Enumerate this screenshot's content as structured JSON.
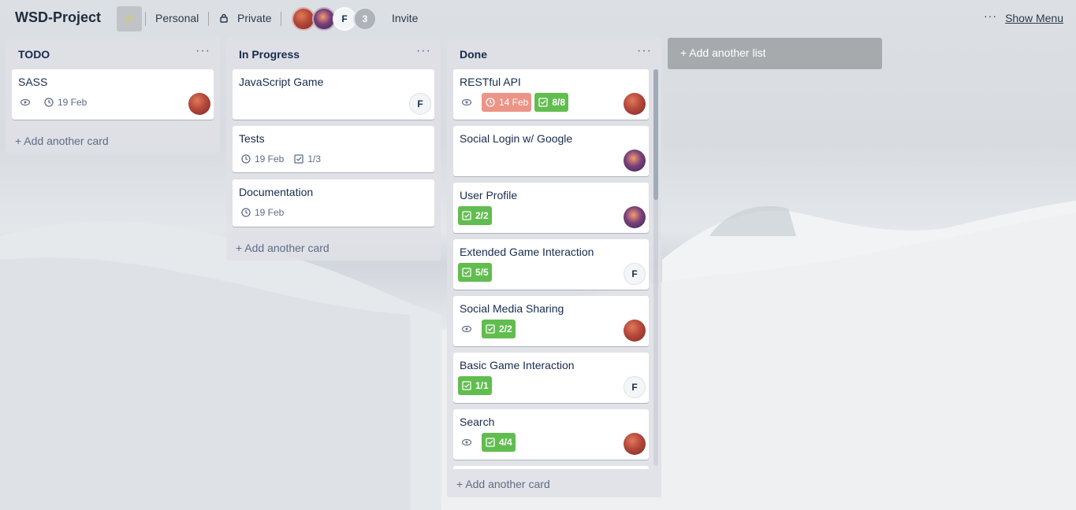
{
  "board": {
    "title": "WSD-Project",
    "team": "Personal",
    "visibility": "Private",
    "member_initial": "F",
    "member_extra_count": "3",
    "invite_label": "Invite",
    "show_menu_label": "Show Menu"
  },
  "lists": [
    {
      "title": "TODO",
      "add_card_label": "+ Add another card",
      "cards": [
        {
          "title": "SASS",
          "watch": true,
          "due": "19 Feb",
          "member": "photo-red"
        }
      ]
    },
    {
      "title": "In Progress",
      "add_card_label": "+ Add another card",
      "cards": [
        {
          "title": "JavaScript Game",
          "member_initial": "F"
        },
        {
          "title": "Tests",
          "due": "19 Feb",
          "checklist": "1/3"
        },
        {
          "title": "Documentation",
          "due": "19 Feb"
        }
      ]
    },
    {
      "title": "Done",
      "add_card_label": "+ Add another card",
      "cards": [
        {
          "title": "RESTful API",
          "watch": true,
          "due": "14 Feb",
          "due_status": "overdue",
          "checklist": "8/8",
          "member": "photo-red"
        },
        {
          "title": "Social Login w/ Google",
          "member": "photo-purple"
        },
        {
          "title": "User Profile",
          "checklist": "2/2",
          "member": "photo-purple"
        },
        {
          "title": "Extended Game Interaction",
          "checklist": "5/5",
          "member_initial": "F"
        },
        {
          "title": "Social Media Sharing",
          "watch": true,
          "checklist": "2/2",
          "member": "photo-red"
        },
        {
          "title": "Basic Game Interaction",
          "checklist": "1/1",
          "member_initial": "F"
        },
        {
          "title": "Search",
          "watch": true,
          "checklist": "4/4",
          "member": "photo-red"
        }
      ]
    }
  ],
  "add_list_label": "+ Add another list",
  "colors": {
    "checklist_complete": "#61bd4f",
    "due_overdue": "#ec9488",
    "star": "#f2d600"
  }
}
